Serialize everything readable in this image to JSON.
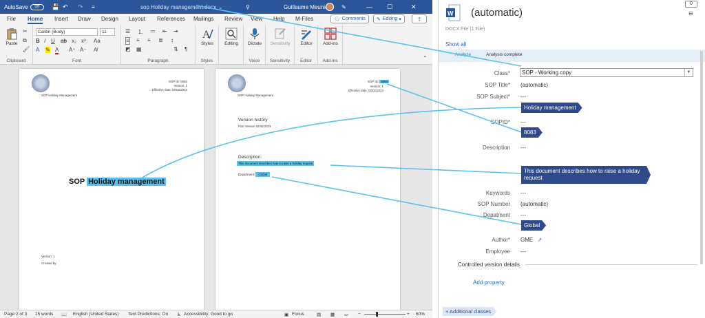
{
  "word": {
    "titlebar": {
      "autosave_label": "AutoSave",
      "autosave_state": "Off",
      "doc_name": "sop Holiday management.docx",
      "user_name": "Guillaume Meunier"
    },
    "tabs": [
      "File",
      "Home",
      "Insert",
      "Draw",
      "Design",
      "Layout",
      "References",
      "Mailings",
      "Review",
      "View",
      "Help",
      "M-Files"
    ],
    "active_tab": "Home",
    "comments_label": "Comments",
    "editing_label": "Editing",
    "ribbon": {
      "paste_label": "Paste",
      "font_name": "Calibri (Body)",
      "font_size": "11",
      "styles_label": "Styles",
      "editing_label": "Editing",
      "dictate_label": "Dictate",
      "sensitivity_label": "Sensitivity",
      "editor_label": "Editor",
      "addins_label": "Add-ins",
      "groups": {
        "clipboard": "Clipboard",
        "font": "Font",
        "paragraph": "Paragraph",
        "styles": "Styles",
        "voice": "Voice",
        "sensitivity": "Sensitivity",
        "editor": "Editor",
        "addins": "Add-ins"
      }
    },
    "page1": {
      "sop_id": "SOP ID: 8083",
      "version": "Version: 1",
      "effective_date": "Effective date: 02/02/2024",
      "header_title": "SOP Holiday Management",
      "main_title_prefix": "SOP",
      "main_title_highlight": "Holiday management",
      "version_line": "Version: 1",
      "created_by": "Created by:"
    },
    "page2": {
      "sop_id_prefix": "SOP ID:",
      "sop_id_value": "8083",
      "version": "Version: 1",
      "effective_date": "Effective date: 02/02/2024",
      "header_title": "SOP Holiday Management",
      "version_history": "Version history",
      "first_version": "First Version 02/02/2024",
      "description_heading": "Description:",
      "description_text": "This document describes how to raise a holiday request",
      "department_label": "Department:",
      "department_value": "Global"
    },
    "statusbar": {
      "page": "Page 2 of 3",
      "words": "25 words",
      "language": "English (United States)",
      "predictions": "Text Predictions: On",
      "accessibility": "Accessibility: Good to go",
      "focus": "Focus",
      "zoom": "60%"
    }
  },
  "mfiles": {
    "badge_count": "0",
    "title": "(automatic)",
    "subtitle": "DOCX File (1 File)",
    "show_all": "Show all",
    "analyze_tab": "Analyze",
    "analysis_status": "Analysis complete",
    "properties": {
      "class_label": "Class*",
      "class_value": "SOP - Working copy",
      "sop_title_label": "SOP Title*",
      "sop_title_value": "(automatic)",
      "sop_subject_label": "SOP Subject*",
      "sop_subject_value": "---",
      "sop_subject_suggestion": "Holiday management",
      "sopid_label": "SOPID*",
      "sopid_value": "---",
      "sopid_suggestion": "8083",
      "description_label": "Description",
      "description_value": "---",
      "description_suggestion": "This document describes how to raise a holiday request",
      "keywords_label": "Keywords",
      "keywords_value": "---",
      "sop_number_label": "SOP Number",
      "sop_number_value": "(automatic)",
      "department_label": "Depatment",
      "department_value": "---",
      "department_suggestion": "Global",
      "author_label": "Author*",
      "author_value": "GME",
      "employee_label": "Employee",
      "employee_value": "---",
      "controlled_version": "Controlled version details",
      "add_property": "Add property",
      "additional_classes": "+ Additional classes"
    },
    "colors": {
      "chip": "#2e4a8a",
      "highlight": "#5bc0eb",
      "word_blue": "#2b579a",
      "link": "#2b6cc4"
    }
  }
}
